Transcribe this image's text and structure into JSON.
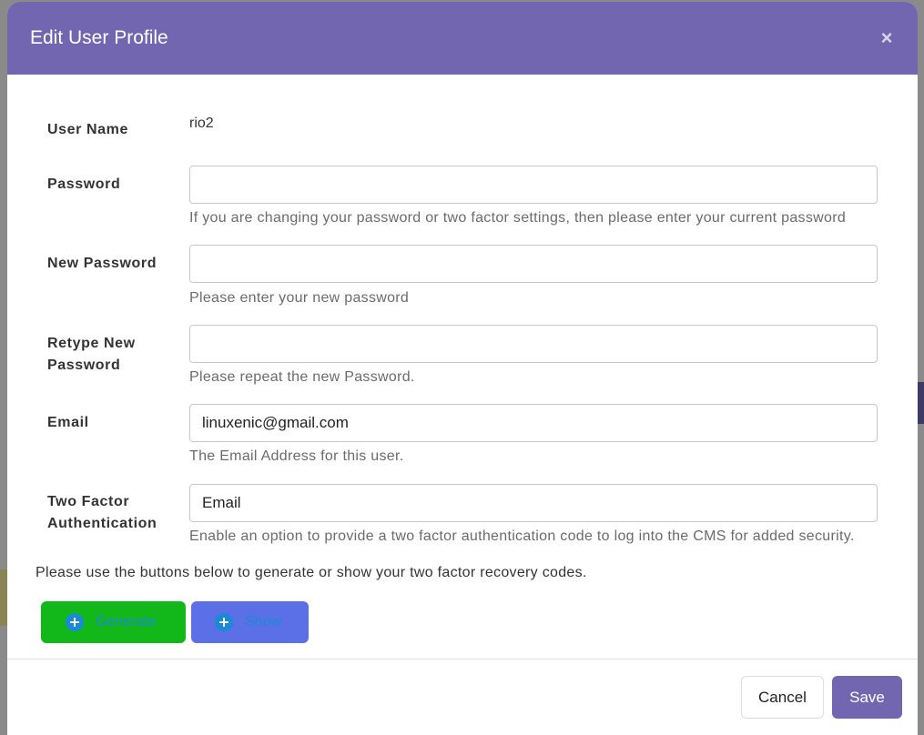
{
  "modal": {
    "title": "Edit User Profile",
    "close_glyph": "×"
  },
  "fields": {
    "username": {
      "label": "User Name",
      "value": "rio2"
    },
    "password": {
      "label": "Password",
      "value": "",
      "help": "If you are changing your password or two factor settings, then please enter your current password"
    },
    "new_password": {
      "label": "New Password",
      "value": "",
      "help": "Please enter your new password"
    },
    "retype_password": {
      "label_line1": "Retype New",
      "label_line2": "Password",
      "value": "",
      "help": "Please repeat the new Password."
    },
    "email": {
      "label": "Email",
      "value": "linuxenic@gmail.com",
      "help": "The Email Address for this user."
    },
    "two_factor": {
      "label_line1": "Two Factor",
      "label_line2": "Authentication",
      "value": "Email",
      "help": "Enable an option to provide a two factor authentication code to log into the CMS for added security."
    }
  },
  "recovery": {
    "note": "Please use the buttons below to generate or show your two factor recovery codes.",
    "generate_label": "Generate",
    "show_label": "Show",
    "icon": "plus-circle-icon"
  },
  "footer": {
    "cancel_label": "Cancel",
    "save_label": "Save"
  },
  "colors": {
    "header": "#7266b0",
    "generate": "#12b81a",
    "show": "#5b70e6",
    "save": "#7266b0"
  }
}
